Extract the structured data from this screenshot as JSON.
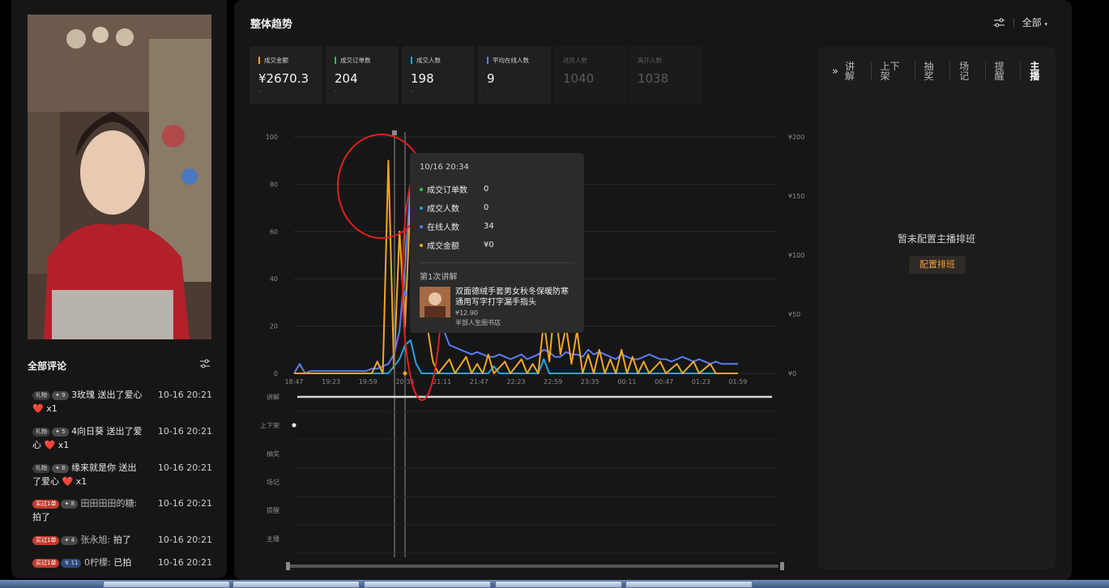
{
  "main": {
    "title": "整体趋势",
    "filter_label": "全部",
    "metrics": [
      {
        "label": "成交金额",
        "value": "¥2670.3",
        "sub": "-",
        "color": "#f5a623",
        "dim": false
      },
      {
        "label": "成交订单数",
        "value": "204",
        "sub": "-",
        "color": "#27c24c",
        "dim": false
      },
      {
        "label": "成交人数",
        "value": "198",
        "sub": "-",
        "color": "#1ca6e8",
        "dim": false
      },
      {
        "label": "平均在线人数",
        "value": "9",
        "sub": "-",
        "color": "#5b7cf2",
        "dim": false
      },
      {
        "label": "进房人数",
        "value": "1040",
        "sub": "",
        "color": "",
        "dim": true
      },
      {
        "label": "离开人数",
        "value": "1038",
        "sub": "",
        "color": "",
        "dim": true
      }
    ]
  },
  "comments": {
    "title": "全部评论",
    "items": [
      {
        "tag": "礼物",
        "tag_type": "gift",
        "level": "9",
        "level_style": "gray",
        "line1": "3玫瑰 送出了爱心",
        "line2_prefix": "",
        "line2_suffix": " x1",
        "heart": "❤️",
        "time": "10-16 20:21"
      },
      {
        "tag": "礼物",
        "tag_type": "gift",
        "level": "5",
        "level_style": "gray",
        "line1": "4向日葵 送出了爱",
        "line2_prefix": "心 ",
        "line2_suffix": " x1",
        "heart": "❤️",
        "time": "10-16 20:21"
      },
      {
        "tag": "礼物",
        "tag_type": "gift",
        "level": "8",
        "level_style": "gray",
        "line1": "缘来就是你 送出",
        "line2_prefix": "了爱心 ",
        "line2_suffix": " x1",
        "heart": "❤️",
        "time": "10-16 20:21"
      },
      {
        "tag": "买过1单",
        "tag_type": "buy",
        "level": "8",
        "level_style": "gray",
        "line1": "田田田田的糖:",
        "line2_prefix": "拍了",
        "line2_suffix": "",
        "heart": "",
        "time": "10-16 20:21"
      },
      {
        "tag": "买过1单",
        "tag_type": "buy",
        "level": "4",
        "level_style": "gray",
        "line1_name": "张永旭:",
        "line1_msg": " 拍了",
        "time": "10-16 20:21"
      },
      {
        "tag": "买过1单",
        "tag_type": "buy",
        "level": "11",
        "level_style": "blue",
        "line1_name": "0柠檬:",
        "line1_msg": " 已拍",
        "time": "10-16 20:21"
      }
    ]
  },
  "right_panel": {
    "tabs": [
      "讲解",
      "上下架",
      "抽奖",
      "场记",
      "提醒",
      "主播"
    ],
    "active_tab": "主播",
    "empty_text": "暂未配置主播排班",
    "config_button": "配置排班"
  },
  "chart_data": {
    "type": "line",
    "x_ticks": [
      "18:47",
      "19:23",
      "19:59",
      "20:35",
      "21:11",
      "21:47",
      "22:23",
      "22:59",
      "23:35",
      "00:11",
      "00:47",
      "01:23",
      "01:59"
    ],
    "y_left_ticks": [
      "0",
      "20",
      "40",
      "60",
      "80",
      "100"
    ],
    "y_right_ticks": [
      "¥0",
      "¥50",
      "¥100",
      "¥150",
      "¥200"
    ],
    "ylim_left": [
      0,
      100
    ],
    "ylim_right": [
      0,
      200
    ],
    "series": [
      {
        "color": "#5b7cf2",
        "axis": "left",
        "points": [
          [
            0,
            0
          ],
          [
            1,
            4
          ],
          [
            2,
            0
          ],
          [
            3,
            1
          ],
          [
            4,
            1
          ],
          [
            5,
            1
          ],
          [
            6,
            1
          ],
          [
            7,
            1
          ],
          [
            8,
            1
          ],
          [
            9,
            1
          ],
          [
            10,
            1
          ],
          [
            11,
            1
          ],
          [
            12,
            1
          ],
          [
            13,
            1
          ],
          [
            14,
            2
          ],
          [
            15,
            2
          ],
          [
            16,
            3
          ],
          [
            17,
            4
          ],
          [
            18,
            8
          ],
          [
            19,
            18
          ],
          [
            20,
            45
          ],
          [
            21,
            80
          ],
          [
            22,
            90
          ],
          [
            23,
            88
          ],
          [
            24,
            70
          ],
          [
            25,
            45
          ],
          [
            26,
            30
          ],
          [
            27,
            18
          ],
          [
            28,
            12
          ],
          [
            29,
            11
          ],
          [
            30,
            10
          ],
          [
            31,
            9
          ],
          [
            32,
            8
          ],
          [
            33,
            9
          ],
          [
            34,
            8
          ],
          [
            35,
            7
          ],
          [
            36,
            7
          ],
          [
            37,
            8
          ],
          [
            38,
            7
          ],
          [
            39,
            6
          ],
          [
            40,
            7
          ],
          [
            41,
            8
          ],
          [
            42,
            6
          ],
          [
            43,
            7
          ],
          [
            44,
            8
          ],
          [
            45,
            10
          ],
          [
            46,
            9
          ],
          [
            47,
            7
          ],
          [
            48,
            7
          ],
          [
            49,
            9
          ],
          [
            50,
            8
          ],
          [
            51,
            8
          ],
          [
            52,
            7
          ],
          [
            53,
            10
          ],
          [
            54,
            8
          ],
          [
            55,
            9
          ],
          [
            56,
            8
          ],
          [
            57,
            7
          ],
          [
            58,
            6
          ],
          [
            59,
            8
          ],
          [
            60,
            7
          ],
          [
            61,
            6
          ],
          [
            62,
            6
          ],
          [
            63,
            7
          ],
          [
            64,
            8
          ],
          [
            65,
            7
          ],
          [
            66,
            6
          ],
          [
            67,
            6
          ],
          [
            68,
            5
          ],
          [
            69,
            6
          ],
          [
            70,
            7
          ],
          [
            71,
            6
          ],
          [
            72,
            5
          ],
          [
            73,
            6
          ],
          [
            74,
            5
          ],
          [
            75,
            4
          ],
          [
            76,
            5
          ],
          [
            77,
            4
          ],
          [
            78,
            4
          ],
          [
            79,
            4
          ],
          [
            80,
            4
          ]
        ]
      },
      {
        "color": "#1ca6e8",
        "axis": "left",
        "points": [
          [
            0,
            0
          ],
          [
            17,
            0
          ],
          [
            18,
            3
          ],
          [
            19,
            6
          ],
          [
            20,
            12
          ],
          [
            21,
            14
          ],
          [
            22,
            4
          ],
          [
            23,
            0
          ],
          [
            35,
            0
          ],
          [
            36,
            3
          ],
          [
            37,
            0
          ],
          [
            44,
            0
          ],
          [
            45,
            6
          ],
          [
            46,
            0
          ],
          [
            80,
            0
          ]
        ]
      },
      {
        "color": "#f5a623",
        "axis": "left",
        "points": [
          [
            0,
            0
          ],
          [
            14,
            0
          ],
          [
            15,
            5
          ],
          [
            16,
            0
          ],
          [
            17,
            90
          ],
          [
            18,
            2
          ],
          [
            19,
            60
          ],
          [
            20,
            20
          ],
          [
            21,
            75
          ],
          [
            22,
            30
          ],
          [
            23,
            80
          ],
          [
            24,
            20
          ],
          [
            25,
            5
          ],
          [
            26,
            0
          ],
          [
            28,
            6
          ],
          [
            29,
            0
          ],
          [
            31,
            7
          ],
          [
            32,
            0
          ],
          [
            33,
            4
          ],
          [
            34,
            0
          ],
          [
            35,
            8
          ],
          [
            36,
            0
          ],
          [
            38,
            5
          ],
          [
            39,
            0
          ],
          [
            41,
            6
          ],
          [
            42,
            0
          ],
          [
            43,
            4
          ],
          [
            44,
            0
          ],
          [
            45,
            22
          ],
          [
            46,
            5
          ],
          [
            47,
            30
          ],
          [
            48,
            8
          ],
          [
            49,
            20
          ],
          [
            50,
            4
          ],
          [
            51,
            18
          ],
          [
            52,
            0
          ],
          [
            53,
            8
          ],
          [
            54,
            0
          ],
          [
            55,
            10
          ],
          [
            56,
            0
          ],
          [
            57,
            6
          ],
          [
            58,
            0
          ],
          [
            59,
            10
          ],
          [
            60,
            0
          ],
          [
            61,
            7
          ],
          [
            62,
            0
          ],
          [
            63,
            5
          ],
          [
            64,
            0
          ],
          [
            66,
            5
          ],
          [
            67,
            0
          ],
          [
            69,
            4
          ],
          [
            70,
            0
          ],
          [
            72,
            5
          ],
          [
            73,
            0
          ],
          [
            75,
            4
          ],
          [
            76,
            0
          ],
          [
            80,
            0
          ]
        ]
      }
    ],
    "lane_labels": [
      "讲解",
      "上下架",
      "抽奖",
      "场记",
      "提醒",
      "主播"
    ],
    "tooltip": {
      "date": "10/16 20:34",
      "rows": [
        {
          "label": "成交订单数",
          "value": "0",
          "color": "#27c24c"
        },
        {
          "label": "成交人数",
          "value": "0",
          "color": "#1ca6e8"
        },
        {
          "label": "在线人数",
          "value": "34",
          "color": "#5b7cf2"
        },
        {
          "label": "成交金额",
          "value": "¥0",
          "color": "#f5a623"
        }
      ],
      "section": "第1次讲解",
      "product_name": "双面德绒手套男女秋冬保暖防寒通用写字打字漏手指头",
      "price": "¥12.90",
      "shop": "半部人生图书店"
    }
  }
}
